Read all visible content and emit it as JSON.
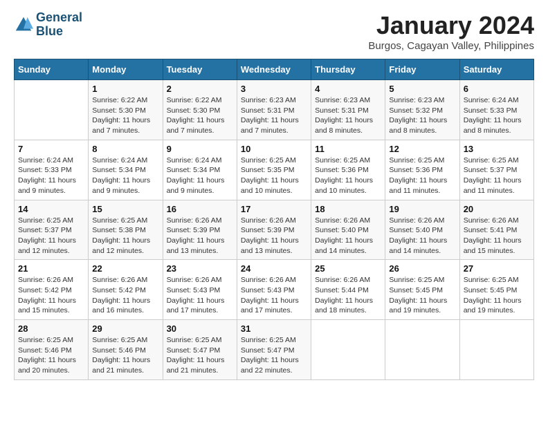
{
  "header": {
    "logo_line1": "General",
    "logo_line2": "Blue",
    "month_title": "January 2024",
    "location": "Burgos, Cagayan Valley, Philippines"
  },
  "days_of_week": [
    "Sunday",
    "Monday",
    "Tuesday",
    "Wednesday",
    "Thursday",
    "Friday",
    "Saturday"
  ],
  "weeks": [
    [
      {
        "day": "",
        "info": ""
      },
      {
        "day": "1",
        "info": "Sunrise: 6:22 AM\nSunset: 5:30 PM\nDaylight: 11 hours\nand 7 minutes."
      },
      {
        "day": "2",
        "info": "Sunrise: 6:22 AM\nSunset: 5:30 PM\nDaylight: 11 hours\nand 7 minutes."
      },
      {
        "day": "3",
        "info": "Sunrise: 6:23 AM\nSunset: 5:31 PM\nDaylight: 11 hours\nand 7 minutes."
      },
      {
        "day": "4",
        "info": "Sunrise: 6:23 AM\nSunset: 5:31 PM\nDaylight: 11 hours\nand 8 minutes."
      },
      {
        "day": "5",
        "info": "Sunrise: 6:23 AM\nSunset: 5:32 PM\nDaylight: 11 hours\nand 8 minutes."
      },
      {
        "day": "6",
        "info": "Sunrise: 6:24 AM\nSunset: 5:33 PM\nDaylight: 11 hours\nand 8 minutes."
      }
    ],
    [
      {
        "day": "7",
        "info": "Sunrise: 6:24 AM\nSunset: 5:33 PM\nDaylight: 11 hours\nand 9 minutes."
      },
      {
        "day": "8",
        "info": "Sunrise: 6:24 AM\nSunset: 5:34 PM\nDaylight: 11 hours\nand 9 minutes."
      },
      {
        "day": "9",
        "info": "Sunrise: 6:24 AM\nSunset: 5:34 PM\nDaylight: 11 hours\nand 9 minutes."
      },
      {
        "day": "10",
        "info": "Sunrise: 6:25 AM\nSunset: 5:35 PM\nDaylight: 11 hours\nand 10 minutes."
      },
      {
        "day": "11",
        "info": "Sunrise: 6:25 AM\nSunset: 5:36 PM\nDaylight: 11 hours\nand 10 minutes."
      },
      {
        "day": "12",
        "info": "Sunrise: 6:25 AM\nSunset: 5:36 PM\nDaylight: 11 hours\nand 11 minutes."
      },
      {
        "day": "13",
        "info": "Sunrise: 6:25 AM\nSunset: 5:37 PM\nDaylight: 11 hours\nand 11 minutes."
      }
    ],
    [
      {
        "day": "14",
        "info": "Sunrise: 6:25 AM\nSunset: 5:37 PM\nDaylight: 11 hours\nand 12 minutes."
      },
      {
        "day": "15",
        "info": "Sunrise: 6:25 AM\nSunset: 5:38 PM\nDaylight: 11 hours\nand 12 minutes."
      },
      {
        "day": "16",
        "info": "Sunrise: 6:26 AM\nSunset: 5:39 PM\nDaylight: 11 hours\nand 13 minutes."
      },
      {
        "day": "17",
        "info": "Sunrise: 6:26 AM\nSunset: 5:39 PM\nDaylight: 11 hours\nand 13 minutes."
      },
      {
        "day": "18",
        "info": "Sunrise: 6:26 AM\nSunset: 5:40 PM\nDaylight: 11 hours\nand 14 minutes."
      },
      {
        "day": "19",
        "info": "Sunrise: 6:26 AM\nSunset: 5:40 PM\nDaylight: 11 hours\nand 14 minutes."
      },
      {
        "day": "20",
        "info": "Sunrise: 6:26 AM\nSunset: 5:41 PM\nDaylight: 11 hours\nand 15 minutes."
      }
    ],
    [
      {
        "day": "21",
        "info": "Sunrise: 6:26 AM\nSunset: 5:42 PM\nDaylight: 11 hours\nand 15 minutes."
      },
      {
        "day": "22",
        "info": "Sunrise: 6:26 AM\nSunset: 5:42 PM\nDaylight: 11 hours\nand 16 minutes."
      },
      {
        "day": "23",
        "info": "Sunrise: 6:26 AM\nSunset: 5:43 PM\nDaylight: 11 hours\nand 17 minutes."
      },
      {
        "day": "24",
        "info": "Sunrise: 6:26 AM\nSunset: 5:43 PM\nDaylight: 11 hours\nand 17 minutes."
      },
      {
        "day": "25",
        "info": "Sunrise: 6:26 AM\nSunset: 5:44 PM\nDaylight: 11 hours\nand 18 minutes."
      },
      {
        "day": "26",
        "info": "Sunrise: 6:25 AM\nSunset: 5:45 PM\nDaylight: 11 hours\nand 19 minutes."
      },
      {
        "day": "27",
        "info": "Sunrise: 6:25 AM\nSunset: 5:45 PM\nDaylight: 11 hours\nand 19 minutes."
      }
    ],
    [
      {
        "day": "28",
        "info": "Sunrise: 6:25 AM\nSunset: 5:46 PM\nDaylight: 11 hours\nand 20 minutes."
      },
      {
        "day": "29",
        "info": "Sunrise: 6:25 AM\nSunset: 5:46 PM\nDaylight: 11 hours\nand 21 minutes."
      },
      {
        "day": "30",
        "info": "Sunrise: 6:25 AM\nSunset: 5:47 PM\nDaylight: 11 hours\nand 21 minutes."
      },
      {
        "day": "31",
        "info": "Sunrise: 6:25 AM\nSunset: 5:47 PM\nDaylight: 11 hours\nand 22 minutes."
      },
      {
        "day": "",
        "info": ""
      },
      {
        "day": "",
        "info": ""
      },
      {
        "day": "",
        "info": ""
      }
    ]
  ]
}
